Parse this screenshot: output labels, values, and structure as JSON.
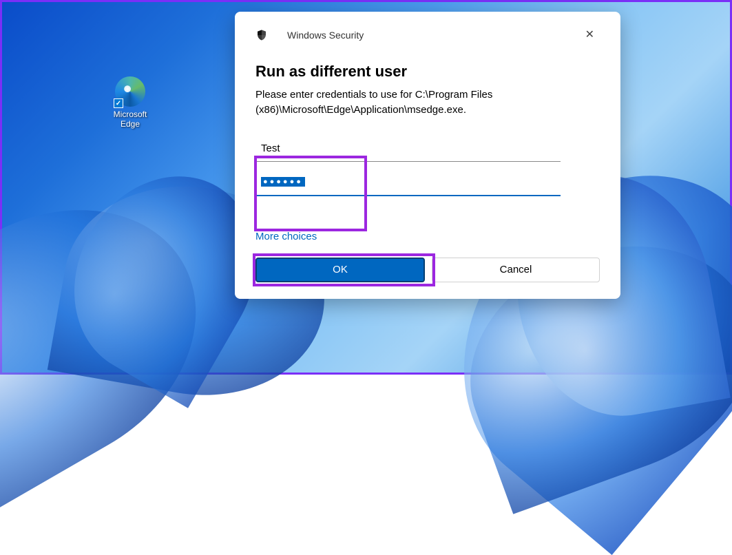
{
  "desktop": {
    "icon_label": "Microsoft Edge"
  },
  "dialog": {
    "header_title": "Windows Security",
    "close_symbol": "✕",
    "heading": "Run as different user",
    "description": "Please enter credentials to use for C:\\Program Files (x86)\\Microsoft\\Edge\\Application\\msedge.exe.",
    "username_value": "Test",
    "password_dots": "●●●●●●",
    "more_choices": "More choices",
    "ok_label": "OK",
    "cancel_label": "Cancel"
  },
  "highlight_color": "#9c27e0"
}
